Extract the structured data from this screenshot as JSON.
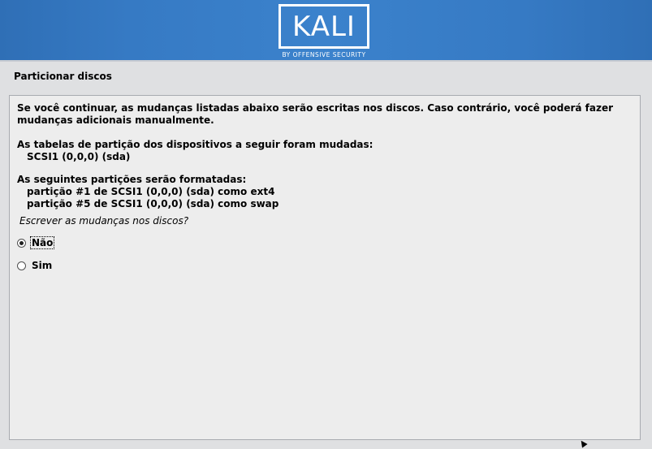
{
  "header": {
    "logo_text": "KALI",
    "logo_subtitle": "BY OFFENSIVE SECURITY",
    "background_color": "#367ac4"
  },
  "page": {
    "title": "Particionar discos"
  },
  "content": {
    "intro_line1": "Se você continuar, as mudanças listadas abaixo serão escritas nos discos. Caso contrário, você poderá fazer",
    "intro_line2": "mudanças adicionais manualmente.",
    "tables_heading": "As tabelas de partição dos dispositivos a seguir foram mudadas:",
    "tables_device": "SCSI1 (0,0,0) (sda)",
    "format_heading": "As seguintes partições serão formatadas:",
    "format_items": [
      "partição #1 de SCSI1 (0,0,0) (sda) como ext4",
      "partição #5 de SCSI1 (0,0,0) (sda) como swap"
    ],
    "question": "Escrever as mudanças nos discos?"
  },
  "options": [
    {
      "label": "Não",
      "selected": true
    },
    {
      "label": "Sim",
      "selected": false
    }
  ],
  "icons": {
    "cursor": "mouse-pointer-icon",
    "radio_checked": "radio-checked-icon",
    "radio_unchecked": "radio-unchecked-icon"
  }
}
